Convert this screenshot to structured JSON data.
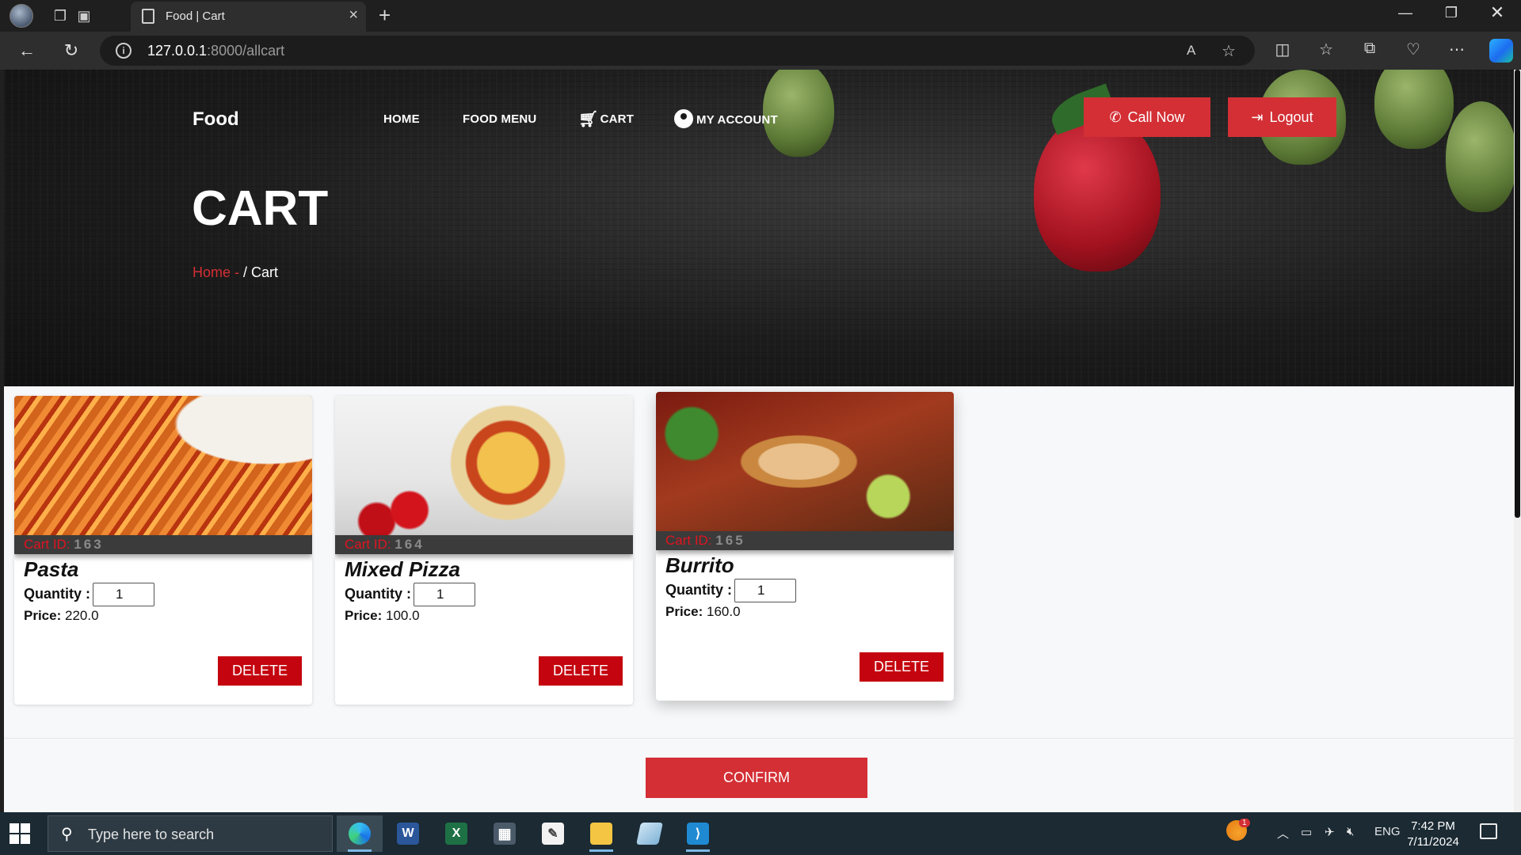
{
  "browser": {
    "tab_title": "Food | Cart",
    "url_host": "127.0.0.1",
    "url_path": ":8000/allcart"
  },
  "site": {
    "brand": "Food",
    "nav": {
      "home": "HOME",
      "food_menu": "FOOD MENU",
      "cart": "CART",
      "account": "MY ACCOUNT"
    },
    "call_now": "Call Now",
    "logout": "Logout",
    "hero_title": "CART",
    "breadcrumb_home": "Home - ",
    "breadcrumb_current": "/ Cart"
  },
  "cart": {
    "id_label": "Cart ID:",
    "qty_label": "Quantity :",
    "price_label": "Price:",
    "delete_label": "DELETE",
    "items": [
      {
        "cart_id": "163",
        "name": "Pasta",
        "quantity": "1",
        "price": "220.0"
      },
      {
        "cart_id": "164",
        "name": "Mixed Pizza",
        "quantity": "1",
        "price": "100.0"
      },
      {
        "cart_id": "165",
        "name": "Burrito",
        "quantity": "1",
        "price": "160.0"
      }
    ],
    "confirm_label": "CONFIRM"
  },
  "taskbar": {
    "search_placeholder": "Type here to search",
    "language": "ENG",
    "time": "7:42 PM",
    "date": "7/11/2024",
    "weather_badge": "1"
  },
  "colors": {
    "accent_red": "#d32f35",
    "delete_red": "#c4040e",
    "cart_id_red": "#e0141f"
  }
}
